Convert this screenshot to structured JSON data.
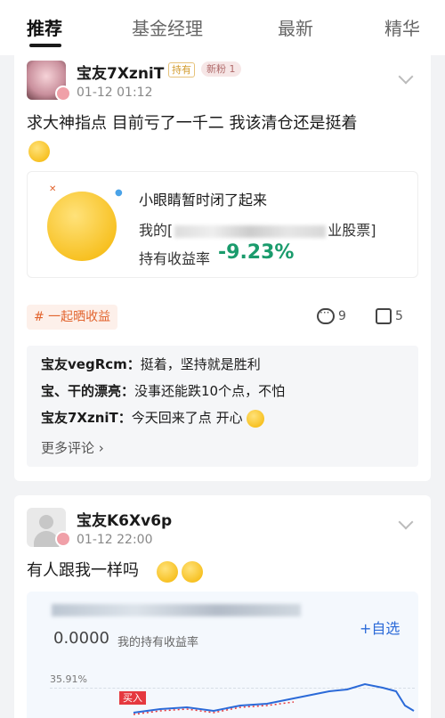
{
  "tabs": [
    {
      "label": "推荐",
      "active": true
    },
    {
      "label": "基金经理",
      "active": false
    },
    {
      "label": "最新",
      "active": false
    },
    {
      "label": "精华",
      "active": false
    }
  ],
  "post1": {
    "username": "宝友7XzniT",
    "hold_tag": "持有",
    "fan_tag": "新粉 1",
    "time": "01-12 01:12",
    "text": "求大神指点 目前亏了一千二 我该清仓还是挺着",
    "holding": {
      "title": "小眼睛暂时闭了起来",
      "line_prefix": "我的[",
      "line_suffix": "业股票]",
      "rate_label": "持有收益率",
      "rate": "-9.23%"
    },
    "topic": "# 一起晒收益",
    "comment_count": "9",
    "like_count": "5",
    "comments": [
      {
        "user": "宝友vegRcm：",
        "text": "挺着，坚持就是胜利"
      },
      {
        "user": "宝、干的漂亮：",
        "text": "没事还能跌10个点，不怕"
      },
      {
        "user": "宝友7XzniT：",
        "text": "今天回来了点 开心"
      }
    ],
    "more_comments": "更多评论 ›"
  },
  "post2": {
    "username": "宝友K6Xv6p",
    "time": "01-12 22:00",
    "text": "有人跟我一样吗",
    "stock": {
      "value": "0.0000",
      "value_label": "我的持有收益率",
      "add_label": "+自选",
      "tick": "35.91%",
      "buy_label": "买入"
    }
  },
  "colors": {
    "loss_green": "#1a9b6c",
    "accent_orange": "#e2642e",
    "link_blue": "#2b6ad8",
    "buy_red": "#e5393f"
  },
  "icons": [
    "chevron-down-icon",
    "comment-icon",
    "like-icon",
    "emoji-icon"
  ]
}
